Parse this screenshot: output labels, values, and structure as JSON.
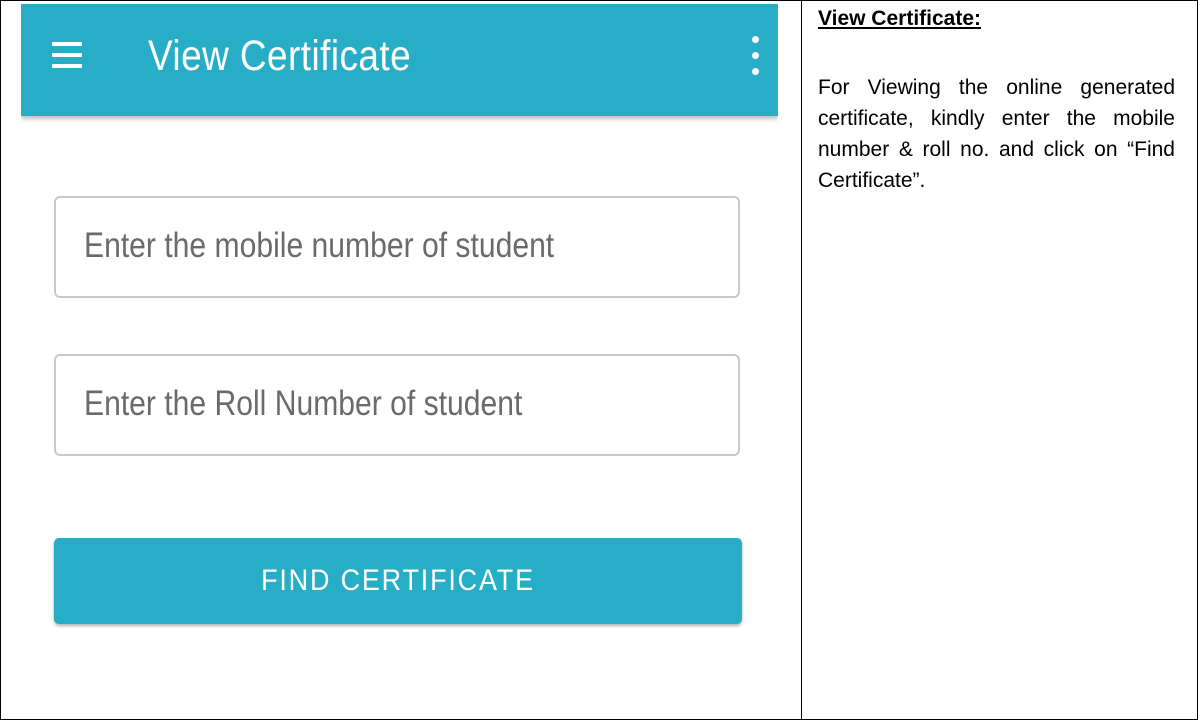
{
  "app": {
    "title": "View Certificate",
    "appbar_color": "#27aec6"
  },
  "icons": {
    "menu": "hamburger-menu-icon",
    "overflow": "more-vertical-icon"
  },
  "form": {
    "mobile_placeholder": "Enter the mobile number of student",
    "mobile_value": "",
    "roll_placeholder": "Enter the Roll Number of student",
    "roll_value": "",
    "find_button_label": "FIND CERTIFICATE"
  },
  "doc": {
    "heading": "View Certificate:",
    "body": "For Viewing the online generated certificate, kindly enter the mobile number & roll no. and click on “Find Certificate”."
  }
}
